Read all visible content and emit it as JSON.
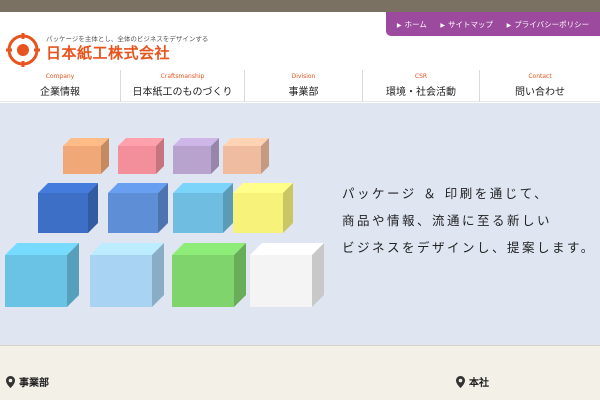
{
  "header": {
    "tagline": "パッケージを主体とし、全体のビジネスをデザインする",
    "company_name": "日本紙工株式会社",
    "colors": {
      "brand_orange": "#e8541e",
      "topbar": "#7a7162"
    }
  },
  "utility_nav": {
    "background": "#9b4a9e",
    "items": [
      {
        "label": "ホーム",
        "icon": "chevron-right-icon"
      },
      {
        "label": "サイトマップ",
        "icon": "chevron-right-icon"
      },
      {
        "label": "プライバシーポリシー",
        "icon": "chevron-right-icon"
      }
    ]
  },
  "global_nav": {
    "items": [
      {
        "en": "Company",
        "ja": "企業情報"
      },
      {
        "en": "Craftsmanship",
        "ja": "日本紙工のものづくり"
      },
      {
        "en": "Division",
        "ja": "事業部"
      },
      {
        "en": "CSR",
        "ja": "環境・社会活動"
      },
      {
        "en": "Contact",
        "ja": "問い合わせ"
      }
    ]
  },
  "hero": {
    "lines": [
      "パッケージ ＆ 印刷を通じて、",
      "商品や情報、流通に至る新しい",
      "ビジネスをデザインし、提案します。"
    ],
    "background": "#dfe6f2",
    "box_colors": [
      [
        "#f1a878",
        "#f28f9a",
        "#b8a3cf",
        "#f0bca0"
      ],
      [
        "#3d6fc6",
        "#5e8ed6",
        "#6fbde0",
        "#f7f27a"
      ],
      [
        "#6ac3e4",
        "#a8d3f2",
        "#7fd46c",
        "#f4f4f4"
      ]
    ]
  },
  "lower": {
    "left_heading": "事業部",
    "right_heading": "本社",
    "icon": "location-pin-icon"
  }
}
